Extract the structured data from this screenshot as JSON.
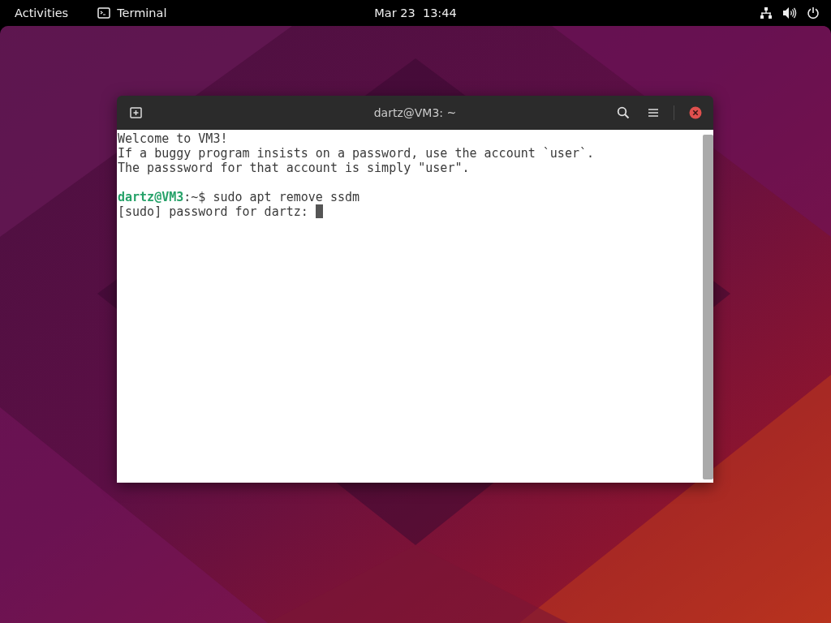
{
  "top_bar": {
    "activities": "Activities",
    "app_menu": {
      "label": "Terminal"
    },
    "clock": "Mar 23  13:44"
  },
  "terminal": {
    "title": "dartz@VM3: ~",
    "lines": [
      {
        "kind": "output",
        "text": "Welcome to VM3!"
      },
      {
        "kind": "output",
        "text": "If a buggy program insists on a password, use the account `user`."
      },
      {
        "kind": "output",
        "text": "The passsword for that account is simply \"user\"."
      },
      {
        "kind": "blank"
      },
      {
        "kind": "prompt",
        "user": "dartz@VM3",
        "text": ":~$ sudo apt remove ssdm"
      },
      {
        "kind": "output",
        "text": "[sudo] password for dartz: ",
        "cursor": true
      }
    ]
  }
}
